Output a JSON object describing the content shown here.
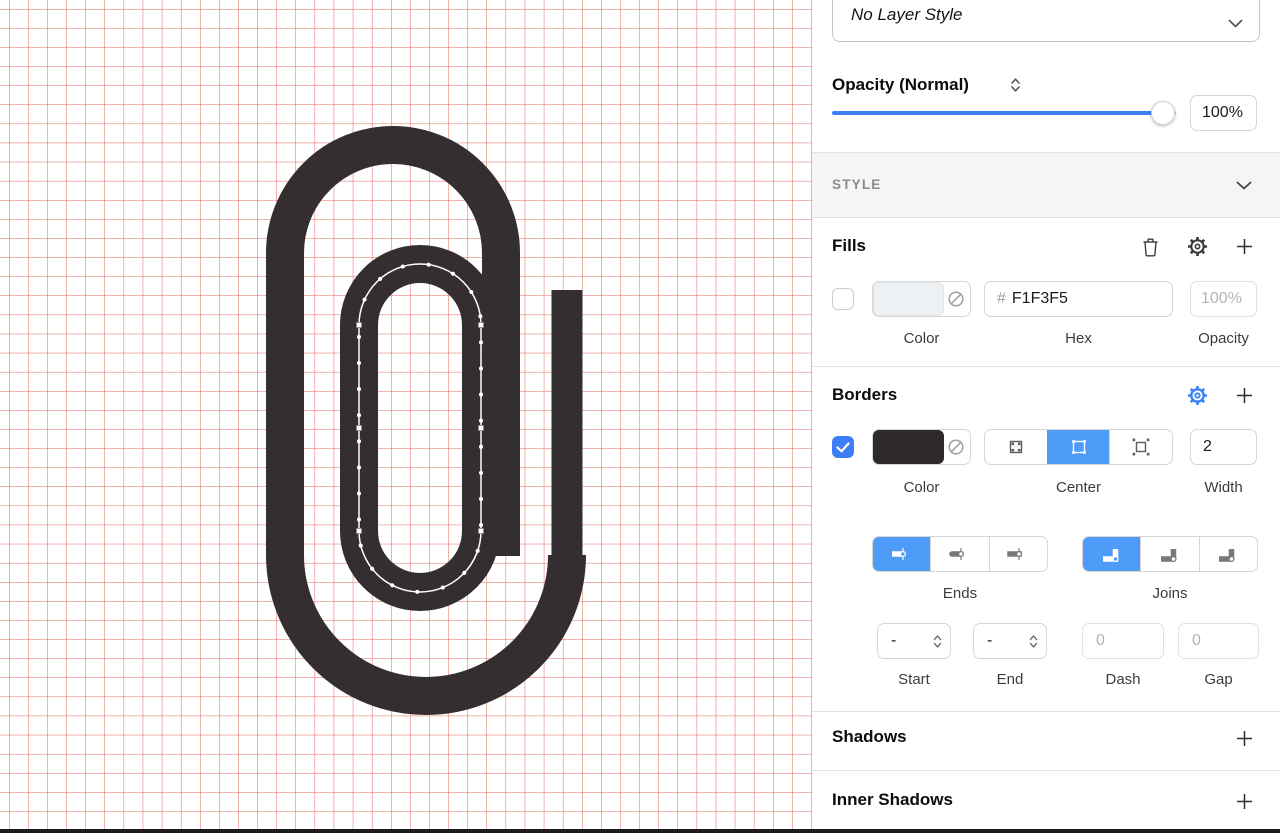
{
  "colors": {
    "accent-blue": "#3D7DF7",
    "segment-blue": "#4F9BF8",
    "gear-blue": "#3B82F7",
    "grid-red": "#DC4A41",
    "shape-dark": "#342E30",
    "fill-swatch": "#EEF1F3",
    "border-swatch": "#2E292B"
  },
  "layer_style": {
    "value": "No Layer Style"
  },
  "opacity": {
    "label": "Opacity (Normal)",
    "value": "100%"
  },
  "style_section": {
    "label": "STYLE"
  },
  "fills": {
    "title": "Fills",
    "hex_prefix": "#",
    "hex_value": "F1F3F5",
    "opacity_value": "100%",
    "labels": {
      "color": "Color",
      "hex": "Hex",
      "opacity": "Opacity"
    }
  },
  "borders": {
    "title": "Borders",
    "width_value": "2",
    "labels": {
      "color": "Color",
      "position": "Center",
      "width": "Width"
    }
  },
  "border_options": {
    "ends_label": "Ends",
    "joins_label": "Joins",
    "start": {
      "label": "Start",
      "value": "-"
    },
    "end": {
      "label": "End",
      "value": "-"
    },
    "dash": {
      "label": "Dash",
      "value": "0"
    },
    "gap": {
      "label": "Gap",
      "value": "0"
    }
  },
  "shadows": {
    "title": "Shadows"
  },
  "inner_shadows": {
    "title": "Inner Shadows"
  }
}
